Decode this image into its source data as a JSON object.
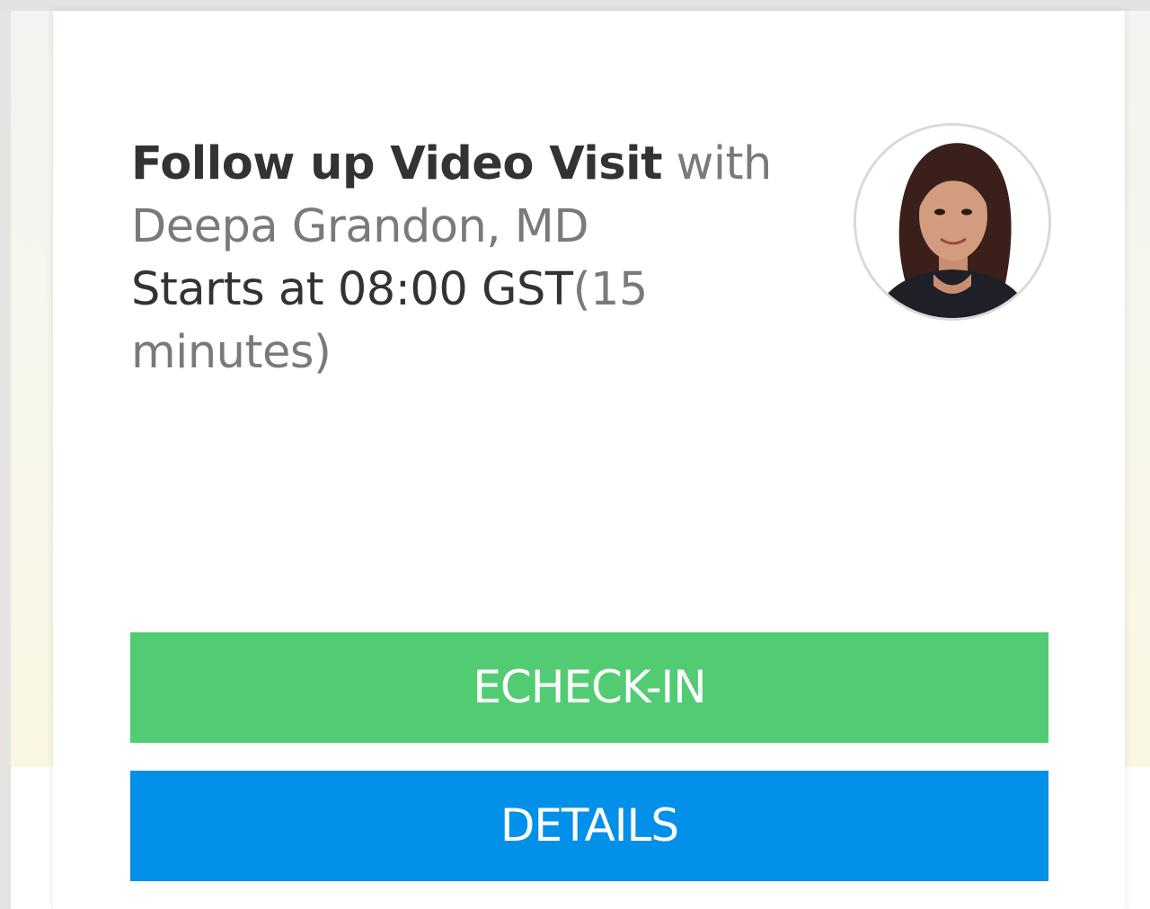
{
  "appointment": {
    "visit_type": "Follow up Video Visit",
    "with_word": " with",
    "provider_name": "Deepa Grandon, MD",
    "starts_at_label": "Starts at 08:00 GST",
    "duration": "(15",
    "duration_unit": "minutes)"
  },
  "actions": {
    "echeckin_label": "ECHECK-IN",
    "details_label": "DETAILS"
  },
  "colors": {
    "echeckin_button": "#52cc72",
    "details_button": "#0390e8",
    "primary_text": "#333333",
    "secondary_text": "#7a7a7a"
  },
  "icons": {
    "provider_photo": "provider-avatar-photo"
  }
}
